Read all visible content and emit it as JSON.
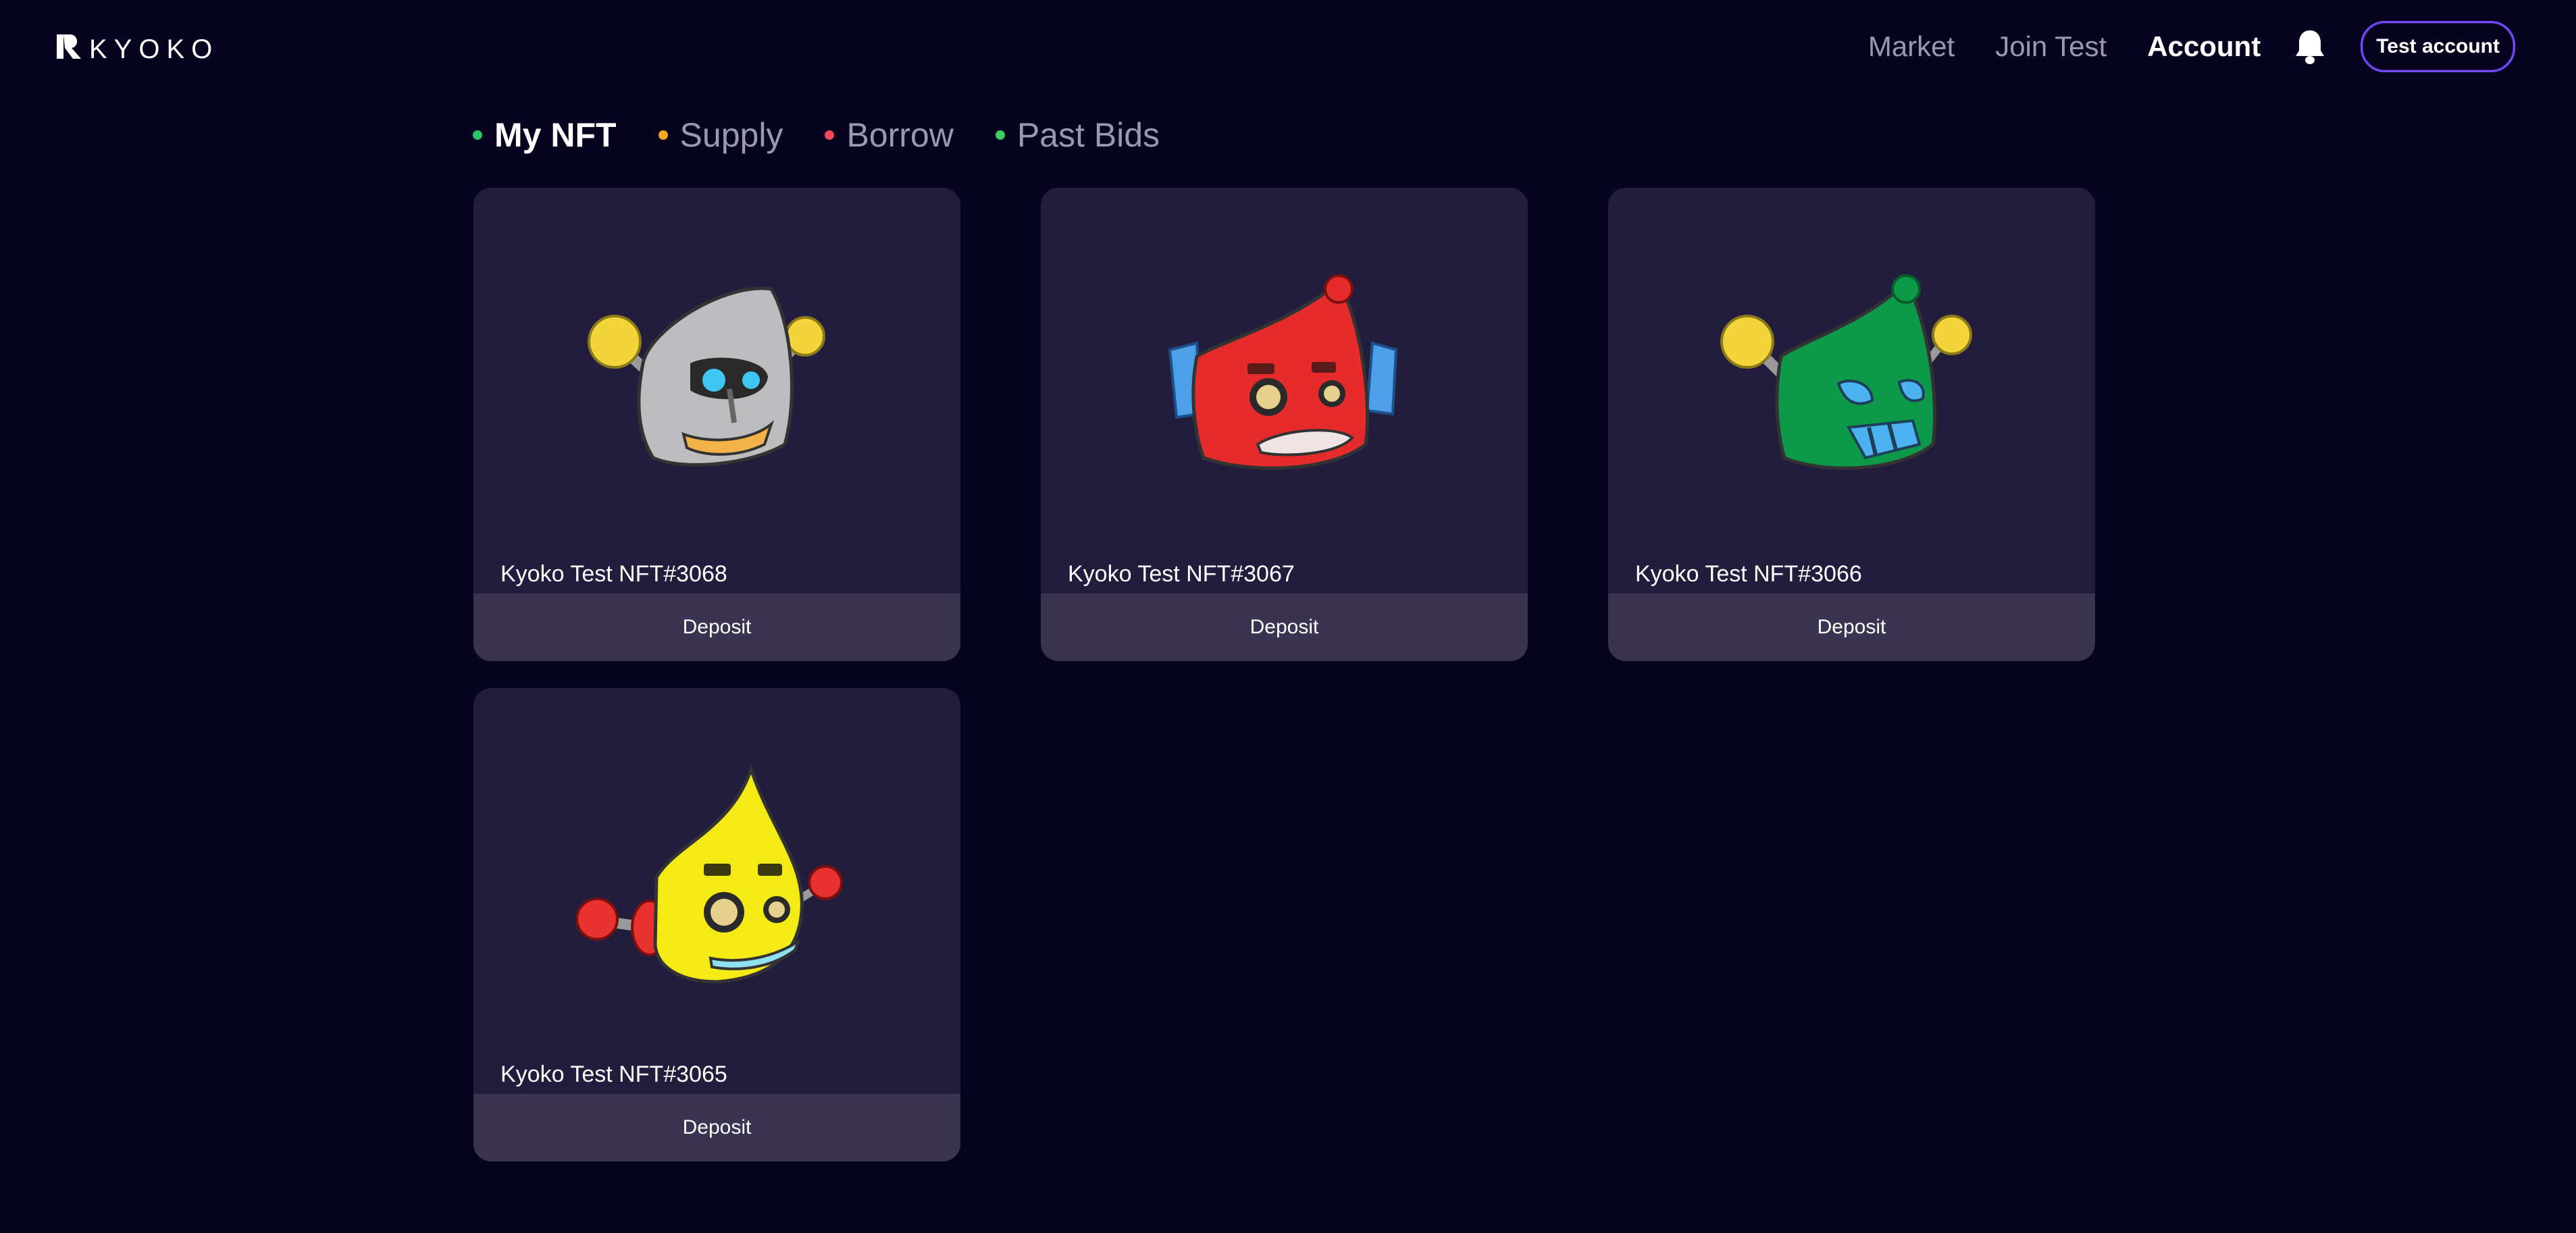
{
  "header": {
    "logo_text": "KYOKO",
    "nav": [
      {
        "label": "Market",
        "active": false
      },
      {
        "label": "Join Test",
        "active": false
      },
      {
        "label": "Account",
        "active": true
      }
    ],
    "notification_icon": "bell-icon",
    "account_button_label": "Test account"
  },
  "tabs": [
    {
      "label": "My NFT",
      "dot_color": "#27c46a",
      "active": true
    },
    {
      "label": "Supply",
      "dot_color": "#f5a623",
      "active": false
    },
    {
      "label": "Borrow",
      "dot_color": "#ef4b5b",
      "active": false
    },
    {
      "label": "Past Bids",
      "dot_color": "#3fce5e",
      "active": false
    }
  ],
  "cards": [
    {
      "title": "Kyoko Test NFT#3068",
      "button_label": "Deposit",
      "robot_color": "#bdbdc0",
      "robot_icon": "grey-robot-nft-image"
    },
    {
      "title": "Kyoko Test NFT#3067",
      "button_label": "Deposit",
      "robot_color": "#e52b2b",
      "robot_icon": "red-robot-nft-image"
    },
    {
      "title": "Kyoko Test NFT#3066",
      "button_label": "Deposit",
      "robot_color": "#0c9a4a",
      "robot_icon": "green-robot-nft-image"
    },
    {
      "title": "Kyoko Test NFT#3065",
      "button_label": "Deposit",
      "robot_color": "#f4ea16",
      "robot_icon": "yellow-robot-nft-image"
    }
  ],
  "colors": {
    "background": "#07041f",
    "card": "#221c3d",
    "card_button": "#3a3452",
    "account_border": "#6d4dff"
  }
}
